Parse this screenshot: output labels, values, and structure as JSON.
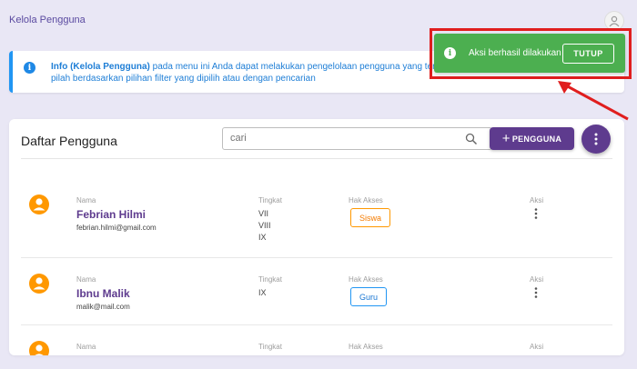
{
  "header": {
    "title": "Kelola Pengguna",
    "avatar_icon": "user-circle-icon"
  },
  "info": {
    "icon": "info-icon",
    "bold": "Info (Kelola Pengguna)",
    "line1": " pada menu ini Anda dapat melakukan pengelolaan pengguna yang tersimpan d",
    "line2": "pilah berdasarkan pilihan filter yang dipilih atau dengan pencarian"
  },
  "toast": {
    "message": "Aksi berhasil dilakukan",
    "button": "TUTUP",
    "color": "#4caf50",
    "highlight_color": "#e01e1e"
  },
  "users_card": {
    "title": "Daftar Pengguna",
    "search_placeholder": "cari",
    "add_button": "PENGGUNA",
    "brand_color": "#5e3b8e",
    "labels": {
      "name": "Nama",
      "level": "Tingkat",
      "access": "Hak Akses",
      "action": "Aksi"
    },
    "rows": [
      {
        "name": "Febrian Hilmi",
        "email": "febrian.hilmi@gmail.com",
        "levels": [
          "VII",
          "VIII",
          "IX"
        ],
        "access": "Siswa"
      },
      {
        "name": "Ibnu Malik",
        "email": "malik@mail.com",
        "levels": [
          "IX"
        ],
        "access": "Guru"
      },
      {
        "name": "",
        "email": "",
        "levels": [],
        "access": ""
      }
    ]
  }
}
